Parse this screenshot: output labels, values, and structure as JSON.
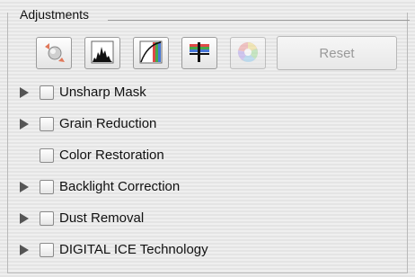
{
  "panel": {
    "title": "Adjustments"
  },
  "toolbar": {
    "tools": [
      {
        "icon": "auto-correction-icon",
        "enabled": true
      },
      {
        "icon": "histogram-icon",
        "enabled": true
      },
      {
        "icon": "tone-curve-icon",
        "enabled": true
      },
      {
        "icon": "color-balance-icon",
        "enabled": true
      },
      {
        "icon": "color-wheel-icon",
        "enabled": false
      }
    ],
    "reset_label": "Reset"
  },
  "options": [
    {
      "label": "Unsharp Mask",
      "expandable": true,
      "checked": false
    },
    {
      "label": "Grain Reduction",
      "expandable": true,
      "checked": false
    },
    {
      "label": "Color Restoration",
      "expandable": false,
      "checked": false
    },
    {
      "label": "Backlight Correction",
      "expandable": true,
      "checked": false
    },
    {
      "label": "Dust Removal",
      "expandable": true,
      "checked": false
    },
    {
      "label": "DIGITAL ICE Technology",
      "expandable": true,
      "checked": false
    }
  ]
}
